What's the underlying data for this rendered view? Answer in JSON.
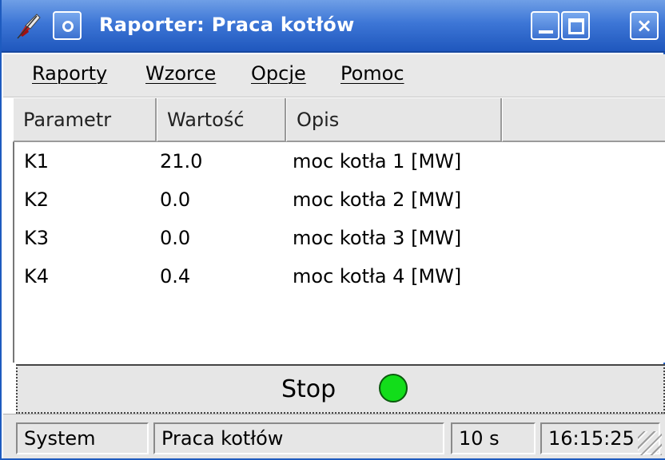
{
  "window": {
    "title": "Raporter: Praca kotłów",
    "icon": "app-feather-icon",
    "controls": {
      "menu": "window-menu-icon",
      "minimize": "minimize-icon",
      "maximize": "maximize-icon",
      "close": "×"
    }
  },
  "menu": {
    "items": [
      {
        "label": "Raporty"
      },
      {
        "label": "Wzorce"
      },
      {
        "label": "Opcje"
      },
      {
        "label": "Pomoc"
      }
    ]
  },
  "table": {
    "columns": [
      "Parametr",
      "Wartość",
      "Opis",
      ""
    ],
    "rows": [
      {
        "param": "K1",
        "value": "21.0",
        "desc": "moc kotła 1 [MW]"
      },
      {
        "param": "K2",
        "value": "0.0",
        "desc": "moc kotła 2 [MW]"
      },
      {
        "param": "K3",
        "value": "0.0",
        "desc": "moc kotła 3 [MW]"
      },
      {
        "param": "K4",
        "value": "0.4",
        "desc": "moc kotła 4 [MW]"
      }
    ]
  },
  "stop": {
    "label": "Stop",
    "led_color": "#12dd1a"
  },
  "status": {
    "system": "System",
    "report": "Praca kotłów",
    "interval": "10 s",
    "time": "16:15:25"
  },
  "colors": {
    "titlebar": "#3d76d6",
    "accent": "#1e5bbf"
  }
}
